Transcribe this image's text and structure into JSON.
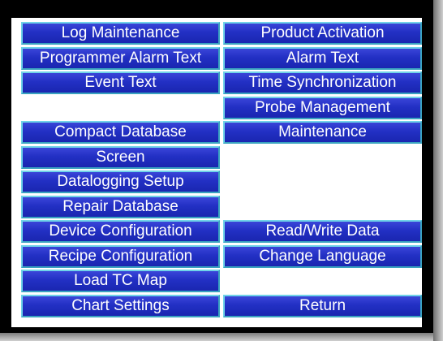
{
  "menu": {
    "left": [
      "Log Maintenance",
      "Programmer Alarm Text",
      "Event Text",
      "",
      "Compact Database",
      "Screen",
      "Datalogging Setup",
      "Repair Database",
      "Device Configuration",
      "Recipe Configuration",
      "Load TC Map",
      "Chart Settings"
    ],
    "right": [
      "Product Activation",
      "Alarm Text",
      "Time Synchronization",
      "Probe Management",
      "Maintenance",
      "",
      "",
      "",
      "Read/Write Data",
      "Change Language",
      "",
      "Return"
    ]
  },
  "colors": {
    "button_fill": "#2230c4",
    "button_border": "#70d3e8",
    "button_text": "#ffffff",
    "panel_bg": "#ffffff",
    "frame": "#000000"
  }
}
